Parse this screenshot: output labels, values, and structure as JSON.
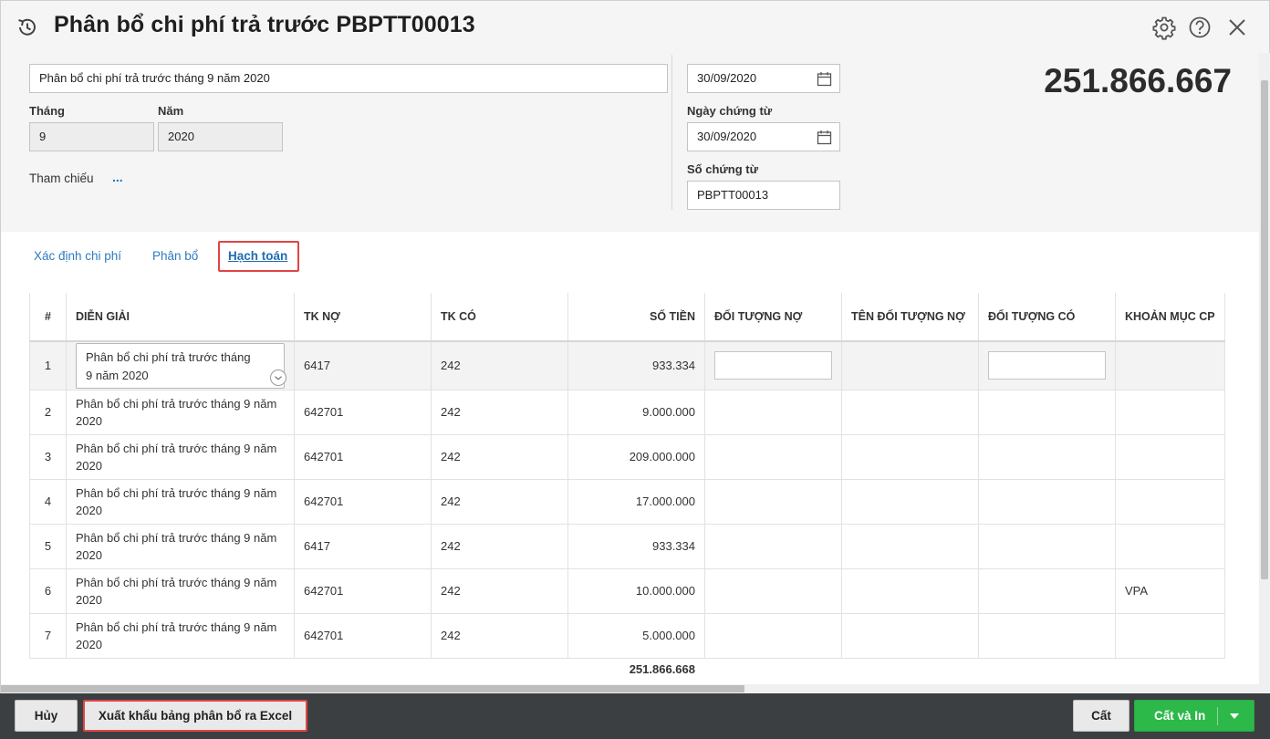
{
  "header": {
    "title": "Phân bổ chi phí trả trước PBPTT00013"
  },
  "form": {
    "description_value": "Phân bổ chi phí trả trước tháng 9 năm 2020",
    "month_label": "Tháng",
    "month_value": "9",
    "year_label": "Năm",
    "year_value": "2020",
    "reference_label": "Tham chiếu",
    "reference_dots": "...",
    "posting_date_value": "30/09/2020",
    "voucher_date_label": "Ngày chứng từ",
    "voucher_date_value": "30/09/2020",
    "voucher_no_label": "Số chứng từ",
    "voucher_no_value": "PBPTT00013",
    "total_amount": "251.866.667"
  },
  "tabs": [
    {
      "label": "Xác định chi phí"
    },
    {
      "label": "Phân bổ"
    },
    {
      "label": "Hạch toán"
    }
  ],
  "grid": {
    "columns": {
      "idx": "#",
      "desc": "DIỄN GIẢI",
      "debit": "TK NỢ",
      "credit": "TK CÓ",
      "amount": "SỐ TIỀN",
      "debit_obj": "ĐỐI TƯỢNG NỢ",
      "debit_obj_name": "TÊN ĐỐI TƯỢNG NỢ",
      "credit_obj": "ĐỐI TƯỢNG CÓ",
      "cost_item": "KHOẢN MỤC CP"
    },
    "rows": [
      {
        "idx": "1",
        "desc": "Phân bổ chi phí trả trước tháng 9 năm 2020",
        "debit": "6417",
        "credit": "242",
        "amount": "933.334",
        "cost_item": ""
      },
      {
        "idx": "2",
        "desc": "Phân bổ chi phí trả trước tháng 9 năm 2020",
        "debit": "642701",
        "credit": "242",
        "amount": "9.000.000",
        "cost_item": ""
      },
      {
        "idx": "3",
        "desc": "Phân bổ chi phí trả trước tháng 9 năm 2020",
        "debit": "642701",
        "credit": "242",
        "amount": "209.000.000",
        "cost_item": ""
      },
      {
        "idx": "4",
        "desc": "Phân bổ chi phí trả trước tháng 9 năm 2020",
        "debit": "642701",
        "credit": "242",
        "amount": "17.000.000",
        "cost_item": ""
      },
      {
        "idx": "5",
        "desc": "Phân bổ chi phí trả trước tháng 9 năm 2020",
        "debit": "6417",
        "credit": "242",
        "amount": "933.334",
        "cost_item": ""
      },
      {
        "idx": "6",
        "desc": "Phân bổ chi phí trả trước tháng 9 năm 2020",
        "debit": "642701",
        "credit": "242",
        "amount": "10.000.000",
        "cost_item": "VPA"
      },
      {
        "idx": "7",
        "desc": "Phân bổ chi phí trả trước tháng 9 năm 2020",
        "debit": "642701",
        "credit": "242",
        "amount": "5.000.000",
        "cost_item": ""
      }
    ],
    "sum_amount": "251.866.668"
  },
  "footer": {
    "cancel_label": "Hủy",
    "export_label": "Xuất khẩu bảng phân bổ ra Excel",
    "save_label": "Cất",
    "save_print_label": "Cất và In"
  },
  "icons": {
    "history": "history-icon",
    "settings": "gear-icon",
    "help": "help-icon",
    "close": "close-icon",
    "calendar": "calendar-icon",
    "chevron": "chevron-down-icon"
  },
  "colors": {
    "accent_link": "#2e7bbf",
    "highlight_red": "#e04545",
    "primary_green": "#2db84a",
    "footer_bg": "#3c3f41"
  }
}
